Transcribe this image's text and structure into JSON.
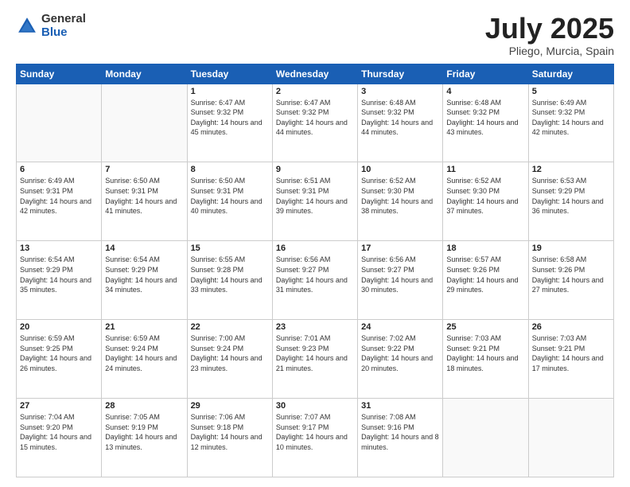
{
  "header": {
    "logo_general": "General",
    "logo_blue": "Blue",
    "month_title": "July 2025",
    "location": "Pliego, Murcia, Spain"
  },
  "calendar": {
    "weekdays": [
      "Sunday",
      "Monday",
      "Tuesday",
      "Wednesday",
      "Thursday",
      "Friday",
      "Saturday"
    ],
    "weeks": [
      [
        {
          "day": "",
          "sunrise": "",
          "sunset": "",
          "daylight": ""
        },
        {
          "day": "",
          "sunrise": "",
          "sunset": "",
          "daylight": ""
        },
        {
          "day": "1",
          "sunrise": "Sunrise: 6:47 AM",
          "sunset": "Sunset: 9:32 PM",
          "daylight": "Daylight: 14 hours and 45 minutes."
        },
        {
          "day": "2",
          "sunrise": "Sunrise: 6:47 AM",
          "sunset": "Sunset: 9:32 PM",
          "daylight": "Daylight: 14 hours and 44 minutes."
        },
        {
          "day": "3",
          "sunrise": "Sunrise: 6:48 AM",
          "sunset": "Sunset: 9:32 PM",
          "daylight": "Daylight: 14 hours and 44 minutes."
        },
        {
          "day": "4",
          "sunrise": "Sunrise: 6:48 AM",
          "sunset": "Sunset: 9:32 PM",
          "daylight": "Daylight: 14 hours and 43 minutes."
        },
        {
          "day": "5",
          "sunrise": "Sunrise: 6:49 AM",
          "sunset": "Sunset: 9:32 PM",
          "daylight": "Daylight: 14 hours and 42 minutes."
        }
      ],
      [
        {
          "day": "6",
          "sunrise": "Sunrise: 6:49 AM",
          "sunset": "Sunset: 9:31 PM",
          "daylight": "Daylight: 14 hours and 42 minutes."
        },
        {
          "day": "7",
          "sunrise": "Sunrise: 6:50 AM",
          "sunset": "Sunset: 9:31 PM",
          "daylight": "Daylight: 14 hours and 41 minutes."
        },
        {
          "day": "8",
          "sunrise": "Sunrise: 6:50 AM",
          "sunset": "Sunset: 9:31 PM",
          "daylight": "Daylight: 14 hours and 40 minutes."
        },
        {
          "day": "9",
          "sunrise": "Sunrise: 6:51 AM",
          "sunset": "Sunset: 9:31 PM",
          "daylight": "Daylight: 14 hours and 39 minutes."
        },
        {
          "day": "10",
          "sunrise": "Sunrise: 6:52 AM",
          "sunset": "Sunset: 9:30 PM",
          "daylight": "Daylight: 14 hours and 38 minutes."
        },
        {
          "day": "11",
          "sunrise": "Sunrise: 6:52 AM",
          "sunset": "Sunset: 9:30 PM",
          "daylight": "Daylight: 14 hours and 37 minutes."
        },
        {
          "day": "12",
          "sunrise": "Sunrise: 6:53 AM",
          "sunset": "Sunset: 9:29 PM",
          "daylight": "Daylight: 14 hours and 36 minutes."
        }
      ],
      [
        {
          "day": "13",
          "sunrise": "Sunrise: 6:54 AM",
          "sunset": "Sunset: 9:29 PM",
          "daylight": "Daylight: 14 hours and 35 minutes."
        },
        {
          "day": "14",
          "sunrise": "Sunrise: 6:54 AM",
          "sunset": "Sunset: 9:29 PM",
          "daylight": "Daylight: 14 hours and 34 minutes."
        },
        {
          "day": "15",
          "sunrise": "Sunrise: 6:55 AM",
          "sunset": "Sunset: 9:28 PM",
          "daylight": "Daylight: 14 hours and 33 minutes."
        },
        {
          "day": "16",
          "sunrise": "Sunrise: 6:56 AM",
          "sunset": "Sunset: 9:27 PM",
          "daylight": "Daylight: 14 hours and 31 minutes."
        },
        {
          "day": "17",
          "sunrise": "Sunrise: 6:56 AM",
          "sunset": "Sunset: 9:27 PM",
          "daylight": "Daylight: 14 hours and 30 minutes."
        },
        {
          "day": "18",
          "sunrise": "Sunrise: 6:57 AM",
          "sunset": "Sunset: 9:26 PM",
          "daylight": "Daylight: 14 hours and 29 minutes."
        },
        {
          "day": "19",
          "sunrise": "Sunrise: 6:58 AM",
          "sunset": "Sunset: 9:26 PM",
          "daylight": "Daylight: 14 hours and 27 minutes."
        }
      ],
      [
        {
          "day": "20",
          "sunrise": "Sunrise: 6:59 AM",
          "sunset": "Sunset: 9:25 PM",
          "daylight": "Daylight: 14 hours and 26 minutes."
        },
        {
          "day": "21",
          "sunrise": "Sunrise: 6:59 AM",
          "sunset": "Sunset: 9:24 PM",
          "daylight": "Daylight: 14 hours and 24 minutes."
        },
        {
          "day": "22",
          "sunrise": "Sunrise: 7:00 AM",
          "sunset": "Sunset: 9:24 PM",
          "daylight": "Daylight: 14 hours and 23 minutes."
        },
        {
          "day": "23",
          "sunrise": "Sunrise: 7:01 AM",
          "sunset": "Sunset: 9:23 PM",
          "daylight": "Daylight: 14 hours and 21 minutes."
        },
        {
          "day": "24",
          "sunrise": "Sunrise: 7:02 AM",
          "sunset": "Sunset: 9:22 PM",
          "daylight": "Daylight: 14 hours and 20 minutes."
        },
        {
          "day": "25",
          "sunrise": "Sunrise: 7:03 AM",
          "sunset": "Sunset: 9:21 PM",
          "daylight": "Daylight: 14 hours and 18 minutes."
        },
        {
          "day": "26",
          "sunrise": "Sunrise: 7:03 AM",
          "sunset": "Sunset: 9:21 PM",
          "daylight": "Daylight: 14 hours and 17 minutes."
        }
      ],
      [
        {
          "day": "27",
          "sunrise": "Sunrise: 7:04 AM",
          "sunset": "Sunset: 9:20 PM",
          "daylight": "Daylight: 14 hours and 15 minutes."
        },
        {
          "day": "28",
          "sunrise": "Sunrise: 7:05 AM",
          "sunset": "Sunset: 9:19 PM",
          "daylight": "Daylight: 14 hours and 13 minutes."
        },
        {
          "day": "29",
          "sunrise": "Sunrise: 7:06 AM",
          "sunset": "Sunset: 9:18 PM",
          "daylight": "Daylight: 14 hours and 12 minutes."
        },
        {
          "day": "30",
          "sunrise": "Sunrise: 7:07 AM",
          "sunset": "Sunset: 9:17 PM",
          "daylight": "Daylight: 14 hours and 10 minutes."
        },
        {
          "day": "31",
          "sunrise": "Sunrise: 7:08 AM",
          "sunset": "Sunset: 9:16 PM",
          "daylight": "Daylight: 14 hours and 8 minutes."
        },
        {
          "day": "",
          "sunrise": "",
          "sunset": "",
          "daylight": ""
        },
        {
          "day": "",
          "sunrise": "",
          "sunset": "",
          "daylight": ""
        }
      ]
    ]
  }
}
